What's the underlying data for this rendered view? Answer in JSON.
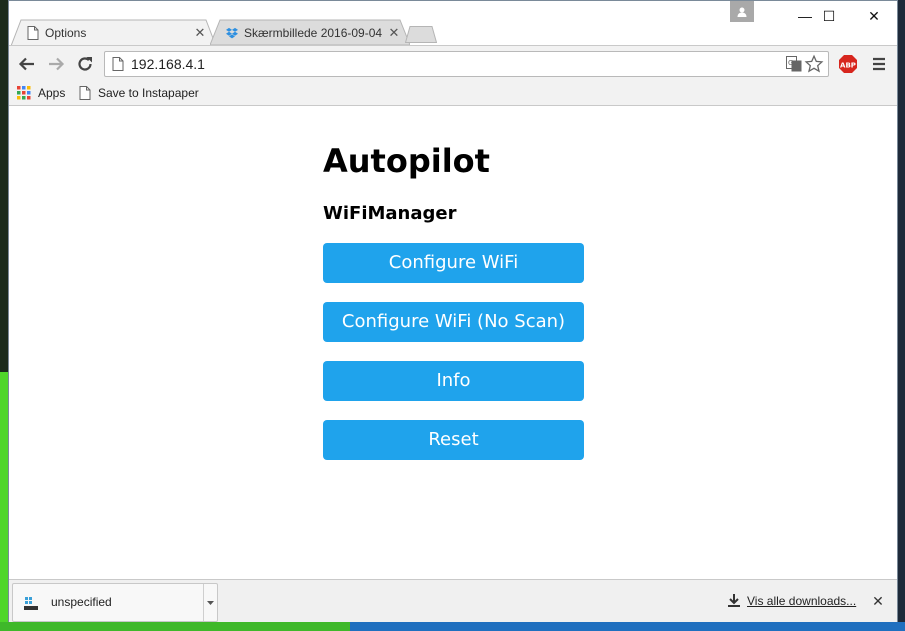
{
  "window": {
    "tabs": [
      {
        "title": "Options",
        "active": true
      },
      {
        "title": "Skærmbillede 2016-09-04",
        "active": false
      }
    ],
    "controls": {
      "minimize": "—",
      "maximize": "☐",
      "close": "✕"
    }
  },
  "toolbar": {
    "url": "192.168.4.1"
  },
  "bookmarks": [
    {
      "label": "Apps",
      "icon": "apps-grid-icon"
    },
    {
      "label": "Save to Instapaper",
      "icon": "page-icon"
    }
  ],
  "page": {
    "title": "Autopilot",
    "subtitle": "WiFiManager",
    "buttons": [
      {
        "label": "Configure WiFi"
      },
      {
        "label": "Configure WiFi (No Scan)"
      },
      {
        "label": "Info"
      },
      {
        "label": "Reset"
      }
    ]
  },
  "download_shelf": {
    "item_name": "unspecified",
    "show_all_label": "Vis alle downloads...",
    "close": "✕"
  },
  "colors": {
    "button_bg": "#1fa3ec",
    "button_text": "#ffffff"
  }
}
